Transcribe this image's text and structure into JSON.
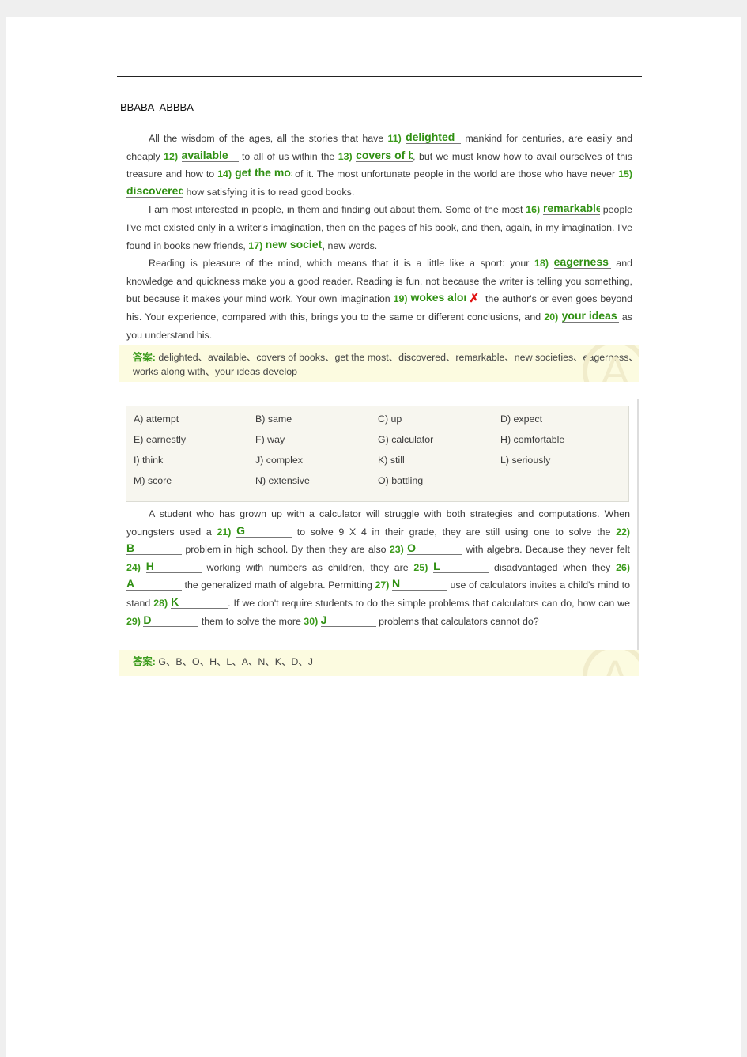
{
  "answer_key_line": "BBABA  ABBBA",
  "section1": {
    "paragraphs": [
      [
        {
          "t": "All the wisdom of the ages, all the stories that have "
        },
        {
          "n": "11)"
        },
        {
          "b": "delighted",
          "w": 70
        },
        {
          "t": " mankind for centuries, are easily and cheaply "
        },
        {
          "n": "12)"
        },
        {
          "b": "available",
          "w": 72
        },
        {
          "t": " to all of us within the "
        },
        {
          "n": "13)"
        },
        {
          "b": "covers of b",
          "w": 72
        },
        {
          "t": ", but we must know how to avail ourselves of this treasure and how to "
        },
        {
          "n": "14)"
        },
        {
          "b": "get the most",
          "w": 72
        },
        {
          "t": " of it. The most unfortunate people in the world are those who have never "
        },
        {
          "n": "15)"
        },
        {
          "b": "discovered",
          "w": 72
        },
        {
          "t": " how satisfying it is to read good books."
        }
      ],
      [
        {
          "t": "I am most interested in people, in them and finding out about them. Some of the most "
        },
        {
          "n": "16)"
        },
        {
          "b": "remarkable",
          "w": 72
        },
        {
          "t": " people I've met existed only in a writer's imagination, then on the pages of his book, and then, again, in my imagination. I've found in books new friends, "
        },
        {
          "n": "17)"
        },
        {
          "b": "new societies",
          "w": 72
        },
        {
          "t": ", new words."
        }
      ],
      [
        {
          "t": "Reading is pleasure of the mind, which means that it is a little like a sport: your "
        },
        {
          "n": "18)"
        },
        {
          "b": "eagerness",
          "w": 72
        },
        {
          "t": " and knowledge and quickness make you a good reader. Reading is fun, not because the writer is telling you something, but because it makes your mind work. Your own imagination "
        },
        {
          "n": "19)"
        },
        {
          "b": "wokes along",
          "w": 70
        },
        {
          "x": "✗"
        },
        {
          "t": " the author's or even goes beyond his. Your experience, compared with this, brings you to the same or different conclusions, and "
        },
        {
          "n": "20)"
        },
        {
          "b": "your ideas",
          "w": 72
        },
        {
          "t": " as you understand his."
        }
      ]
    ],
    "answer_label": "答案:",
    "answer_text": "delighted、available、covers of books、get the most、discovered、remarkable、new societies、eagerness、works along with、your ideas develop"
  },
  "section2": {
    "options": [
      "A) attempt",
      "B) same",
      "C) up",
      "D) expect",
      "E) earnestly",
      "F) way",
      "G) calculator",
      "H) comfortable",
      "I) think",
      "J) complex",
      "K) still",
      "L) seriously",
      "M) score",
      "N) extensive",
      "O) battling"
    ],
    "paragraphs": [
      [
        {
          "t": "A student who has grown up with a calculator will struggle with both strategies and computations. When youngsters used a "
        },
        {
          "n": "21)"
        },
        {
          "b": "G",
          "w": 70
        },
        {
          "t": " to solve 9 X 4 in their grade, they are still using one to solve the "
        },
        {
          "n": "22)"
        },
        {
          "b": "B",
          "w": 70
        },
        {
          "t": " problem in high school. By then they are also "
        },
        {
          "n": "23)"
        },
        {
          "b": "O",
          "w": 70
        },
        {
          "t": " with algebra. Because they never felt "
        },
        {
          "n": "24)"
        },
        {
          "b": "H",
          "w": 70
        },
        {
          "t": " working with numbers as children, they are "
        },
        {
          "n": "25)"
        },
        {
          "b": "L",
          "w": 70
        },
        {
          "t": " disadvantaged when they "
        },
        {
          "n": "26)"
        },
        {
          "b": "A",
          "w": 70
        },
        {
          "t": " the generalized math of algebra. Permitting "
        },
        {
          "n": "27)"
        },
        {
          "b": "N",
          "w": 70
        },
        {
          "t": " use of calculators invites a child's mind to stand "
        },
        {
          "n": "28)"
        },
        {
          "b": "K",
          "w": 72
        },
        {
          "t": ". If we don't require students to do the simple problems that calculators can do, how can we "
        },
        {
          "n": "29)"
        },
        {
          "b": "D",
          "w": 70
        },
        {
          "t": " them to solve the more "
        },
        {
          "n": "30)"
        },
        {
          "b": "J",
          "w": 70
        },
        {
          "t": " problems that calculators cannot do?"
        }
      ]
    ],
    "answer_label": "答案:",
    "answer_text": "G、B、O、H、L、A、N、K、D、J"
  },
  "colors": {
    "green": "#3a9a1a",
    "answer_bg": "#fcfbe0",
    "wrong_mark": "#e01010"
  }
}
